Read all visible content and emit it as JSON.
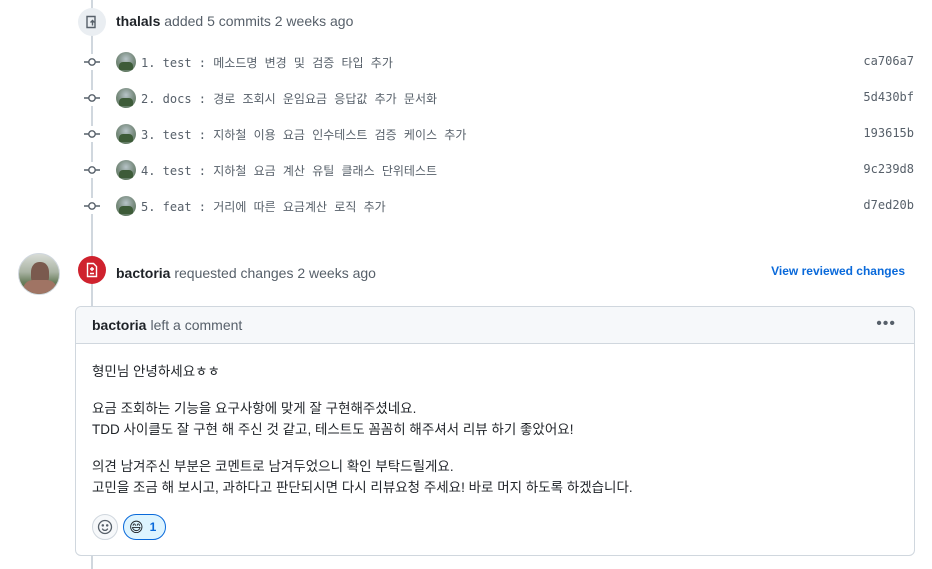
{
  "push_event": {
    "author": "thalals",
    "action": "added 5 commits 2 weeks ago"
  },
  "commits": [
    {
      "message": "1. test : 메소드명 변경 및 검증 타입 추가",
      "sha": "ca706a7"
    },
    {
      "message": "2. docs : 경로 조회시 운임요금 응답값 추가 문서화",
      "sha": "5d430bf"
    },
    {
      "message": "3. test : 지하철 이용 요금 인수테스트 검증 케이스 추가",
      "sha": "193615b"
    },
    {
      "message": "4. test : 지하철 요금 계산 유틸 클래스 단위테스트",
      "sha": "9c239d8"
    },
    {
      "message": "5. feat : 거리에 따른 요금계산 로직 추가",
      "sha": "d7ed20b"
    }
  ],
  "review_event": {
    "author": "bactoria",
    "action": "requested changes 2 weeks ago",
    "view_link": "View reviewed changes"
  },
  "comment": {
    "author": "bactoria",
    "action": "left a comment",
    "menu_icon": "kebab-horizontal-icon",
    "paragraphs": [
      [
        "형민님 안녕하세요ㅎㅎ"
      ],
      [
        "요금 조회하는 기능을 요구사항에 맞게 잘 구현해주셨네요.",
        "TDD 사이클도 잘 구현 해 주신 것 같고, 테스트도 꼼꼼히 해주셔서 리뷰 하기 좋았어요!"
      ],
      [
        "의견 남겨주신 부분은 코멘트로 남겨두었으니 확인 부탁드릴게요.",
        "고민을 조금 해 보시고, 과하다고 판단되시면 다시 리뷰요청 주세요! 바로 머지 하도록 하겠습니다."
      ]
    ],
    "reactions": [
      {
        "emoji": "😄",
        "count": "1"
      }
    ]
  },
  "colors": {
    "danger": "#cf222e",
    "accent": "#0969da",
    "muted": "#57606a",
    "border": "#d0d7de"
  }
}
